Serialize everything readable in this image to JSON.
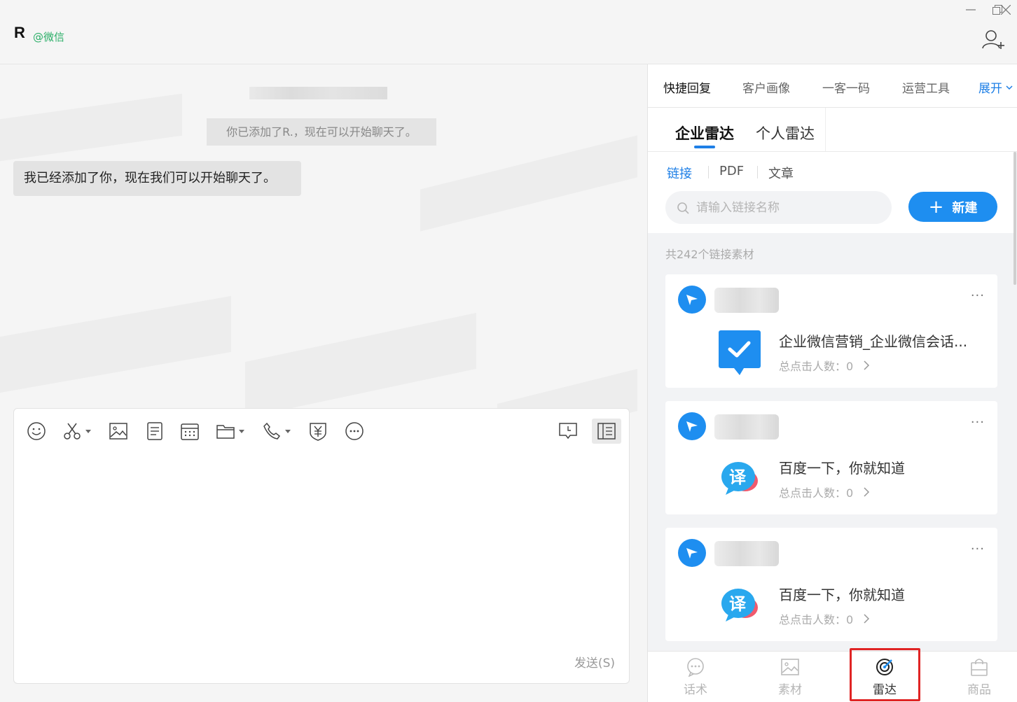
{
  "header": {
    "contact_name": "R",
    "contact_tag": "@微信"
  },
  "chat": {
    "system_message": "你已添加了R.，现在可以开始聊天了。",
    "bubble_message": "我已经添加了你，现在我们可以开始聊天了。"
  },
  "composer": {
    "send_label": "发送(S)",
    "tools": [
      "emoji-icon",
      "screenshot-scissors-icon",
      "image-icon",
      "document-icon",
      "calendar-icon",
      "folder-icon",
      "phone-icon",
      "payment-shield-icon",
      "more-icon",
      "history-icon",
      "sidebar-toggle-icon"
    ]
  },
  "panel": {
    "top_tabs": [
      "快捷回复",
      "客户画像",
      "一客一码",
      "运营工具"
    ],
    "expand_label": "展开",
    "radar_tabs": [
      "企业雷达",
      "个人雷达"
    ],
    "filter_tabs": [
      "链接",
      "PDF",
      "文章"
    ],
    "search_placeholder": "请输入链接名称",
    "new_label": "新建",
    "count_text": "共242个链接素材",
    "accent_color": "#1e8ef0",
    "cards": [
      {
        "title": "企业微信营销_企业微信会话...",
        "clicks": "总点击人数：0",
        "thumb": "wecom-check-icon"
      },
      {
        "title": "百度一下，你就知道",
        "clicks": "总点击人数：0",
        "thumb": "translate-bubble-icon"
      },
      {
        "title": "百度一下，你就知道",
        "clicks": "总点击人数：0",
        "thumb": "translate-bubble-icon"
      }
    ],
    "bottom_nav": [
      "话术",
      "素材",
      "雷达",
      "商品"
    ],
    "bottom_nav_active": "雷达",
    "highlight_color": "#e02424"
  }
}
